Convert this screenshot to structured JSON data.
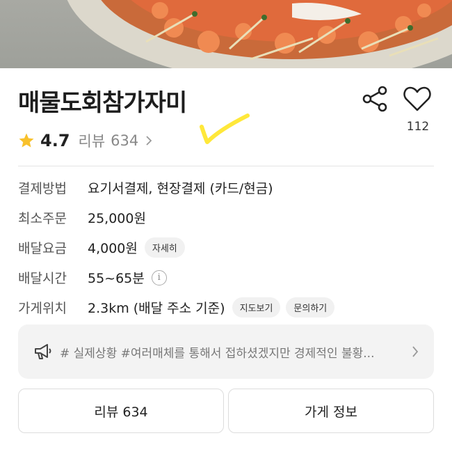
{
  "store": {
    "name": "매물도회참가자미",
    "rating": "4.7",
    "review_label": "리뷰",
    "review_count": "634",
    "like_count": "112"
  },
  "info": {
    "rows": [
      {
        "label": "결제방법",
        "value": "요기서결제, 현장결제 (카드/현금)"
      },
      {
        "label": "최소주문",
        "value": "25,000원"
      },
      {
        "label": "배달요금",
        "value": "4,000원",
        "chip": "자세히"
      },
      {
        "label": "배달시간",
        "value": "55~65분",
        "info_icon": "i"
      },
      {
        "label": "가게위치",
        "value": "2.3km (배달 주소 기준)",
        "chips": [
          "지도보기",
          "문의하기"
        ]
      }
    ]
  },
  "notice": {
    "text": "# 실제상황 #여러매체를 통해서 접하셨겠지만 경제적인 불황..."
  },
  "buttons": {
    "review": "리뷰 634",
    "store_info": "가게 정보"
  },
  "colors": {
    "star": "#f8c12c",
    "annotation_check": "#ffe83a"
  },
  "icons": [
    "star-icon",
    "share-icon",
    "heart-icon",
    "info-icon",
    "megaphone-icon",
    "chevron-right-icon"
  ]
}
